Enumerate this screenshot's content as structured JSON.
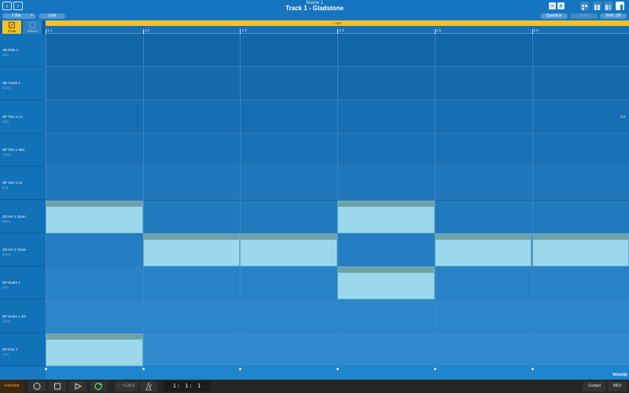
{
  "header": {
    "scene": "Scene 1",
    "track": "Track 1 - Gladstone",
    "back_icon": "chevron-left-icon",
    "forward_icon": "chevron-right-icon",
    "zoom_out": "−",
    "zoom_in": "+"
  },
  "toolbar": {
    "length": "1 Bar",
    "length_plus": "+",
    "loop": "Loop",
    "quantize": "Quantize",
    "undo": "Undo",
    "grid": "Grid: 1/8"
  },
  "tools": {
    "draw": "Draw",
    "select": "Select"
  },
  "bar_strip": "1 Bar",
  "ruler": [
    "1.1",
    "1.2",
    "1.3",
    "1.4",
    "1.5",
    "1.6"
  ],
  "lanes": [
    {
      "name": "SB Ride 1",
      "note": "(A3)"
    },
    {
      "name": "SB Crash 1",
      "note": "(C#3)"
    },
    {
      "name": "SP Tom 1 Lo",
      "note": "(D3)"
    },
    {
      "name": "SP Tom 1 Mid",
      "note": "(F#3)"
    },
    {
      "name": "SP Tom 1 Hi",
      "note": "(F3)"
    },
    {
      "name": "ZD HH 1 Open",
      "note": "(A#2)"
    },
    {
      "name": "ZD HH 1 Close",
      "note": "(G#2)"
    },
    {
      "name": "SP Snare 1",
      "note": "(D2)"
    },
    {
      "name": "SP Snare 1 SS",
      "note": "(C#2)"
    },
    {
      "name": "SP Kick 1",
      "note": "(C2)"
    }
  ],
  "notes": [
    {
      "lane": 5,
      "step": 0
    },
    {
      "lane": 5,
      "step": 3
    },
    {
      "lane": 6,
      "step": 1
    },
    {
      "lane": 6,
      "step": 2
    },
    {
      "lane": 6,
      "step": 4
    },
    {
      "lane": 6,
      "step": 5
    },
    {
      "lane": 7,
      "step": 3
    },
    {
      "lane": 9,
      "step": 0
    }
  ],
  "right_edge_label": "G3",
  "velocity_label": "Velocity",
  "transport": {
    "function": "Function",
    "tempo": "♩=128.0",
    "position": "1: 1: 1",
    "gadget": "Gadget",
    "midi": "MIDI"
  },
  "colors": {
    "accent": "#f2c12e",
    "note": "#9bd8ec",
    "function": "#f5a623",
    "record": "#4cd964"
  }
}
